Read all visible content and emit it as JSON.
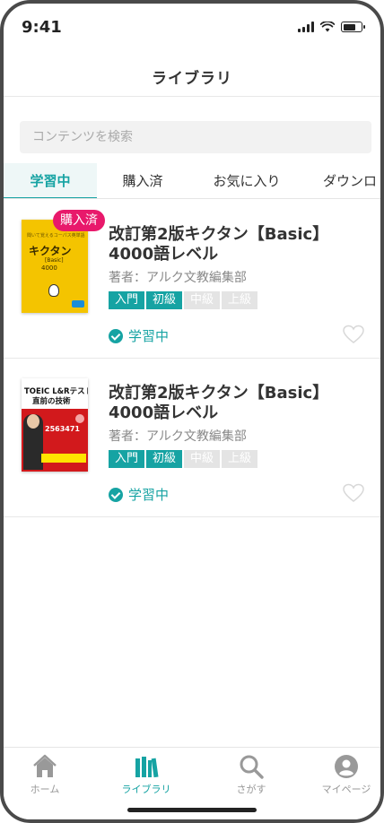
{
  "status_bar": {
    "time": "9:41"
  },
  "header": {
    "title": "ライブラリ"
  },
  "search": {
    "placeholder": "コンテンツを検索"
  },
  "tabs": [
    {
      "label": "学習中",
      "active": true
    },
    {
      "label": "購入済",
      "active": false
    },
    {
      "label": "お気に入り",
      "active": false
    },
    {
      "label": "ダウンロ",
      "active": false
    }
  ],
  "items": [
    {
      "badge": "購入済",
      "title": "改訂第2版キクタン【Basic】4000語レベル",
      "author": "著者：アルク文教編集部",
      "levels": [
        {
          "label": "入門",
          "active": true
        },
        {
          "label": "初級",
          "active": true
        },
        {
          "label": "中級",
          "active": false
        },
        {
          "label": "上級",
          "active": false
        }
      ],
      "status": "学習中",
      "favorited": false,
      "cover": {
        "top_text": "聞いて覚えるコーパス英単語",
        "title": "キクタン",
        "subtitle": "[Basic]",
        "number": "4000"
      }
    },
    {
      "badge": "",
      "title": "改訂第2版キクタン【Basic】4000語レベル",
      "author": "著者：アルク文教編集部",
      "levels": [
        {
          "label": "入門",
          "active": true
        },
        {
          "label": "初級",
          "active": true
        },
        {
          "label": "中級",
          "active": false
        },
        {
          "label": "上級",
          "active": false
        }
      ],
      "status": "学習中",
      "favorited": false,
      "cover": {
        "title_line1": "TOEIC L&Rテスト",
        "title_line2": "直前の技術",
        "number": "2563471",
        "band": "爆速スコアアップ"
      }
    }
  ],
  "bottom_nav": [
    {
      "label": "ホーム",
      "icon": "home-icon",
      "active": false
    },
    {
      "label": "ライブラリ",
      "icon": "library-icon",
      "active": true
    },
    {
      "label": "さがす",
      "icon": "search-icon",
      "active": false
    },
    {
      "label": "マイページ",
      "icon": "user-icon",
      "active": false
    }
  ],
  "colors": {
    "accent": "#16a3a3",
    "badge": "#e8196b",
    "cover_yellow": "#f4c400",
    "cover_red": "#d2191c"
  }
}
